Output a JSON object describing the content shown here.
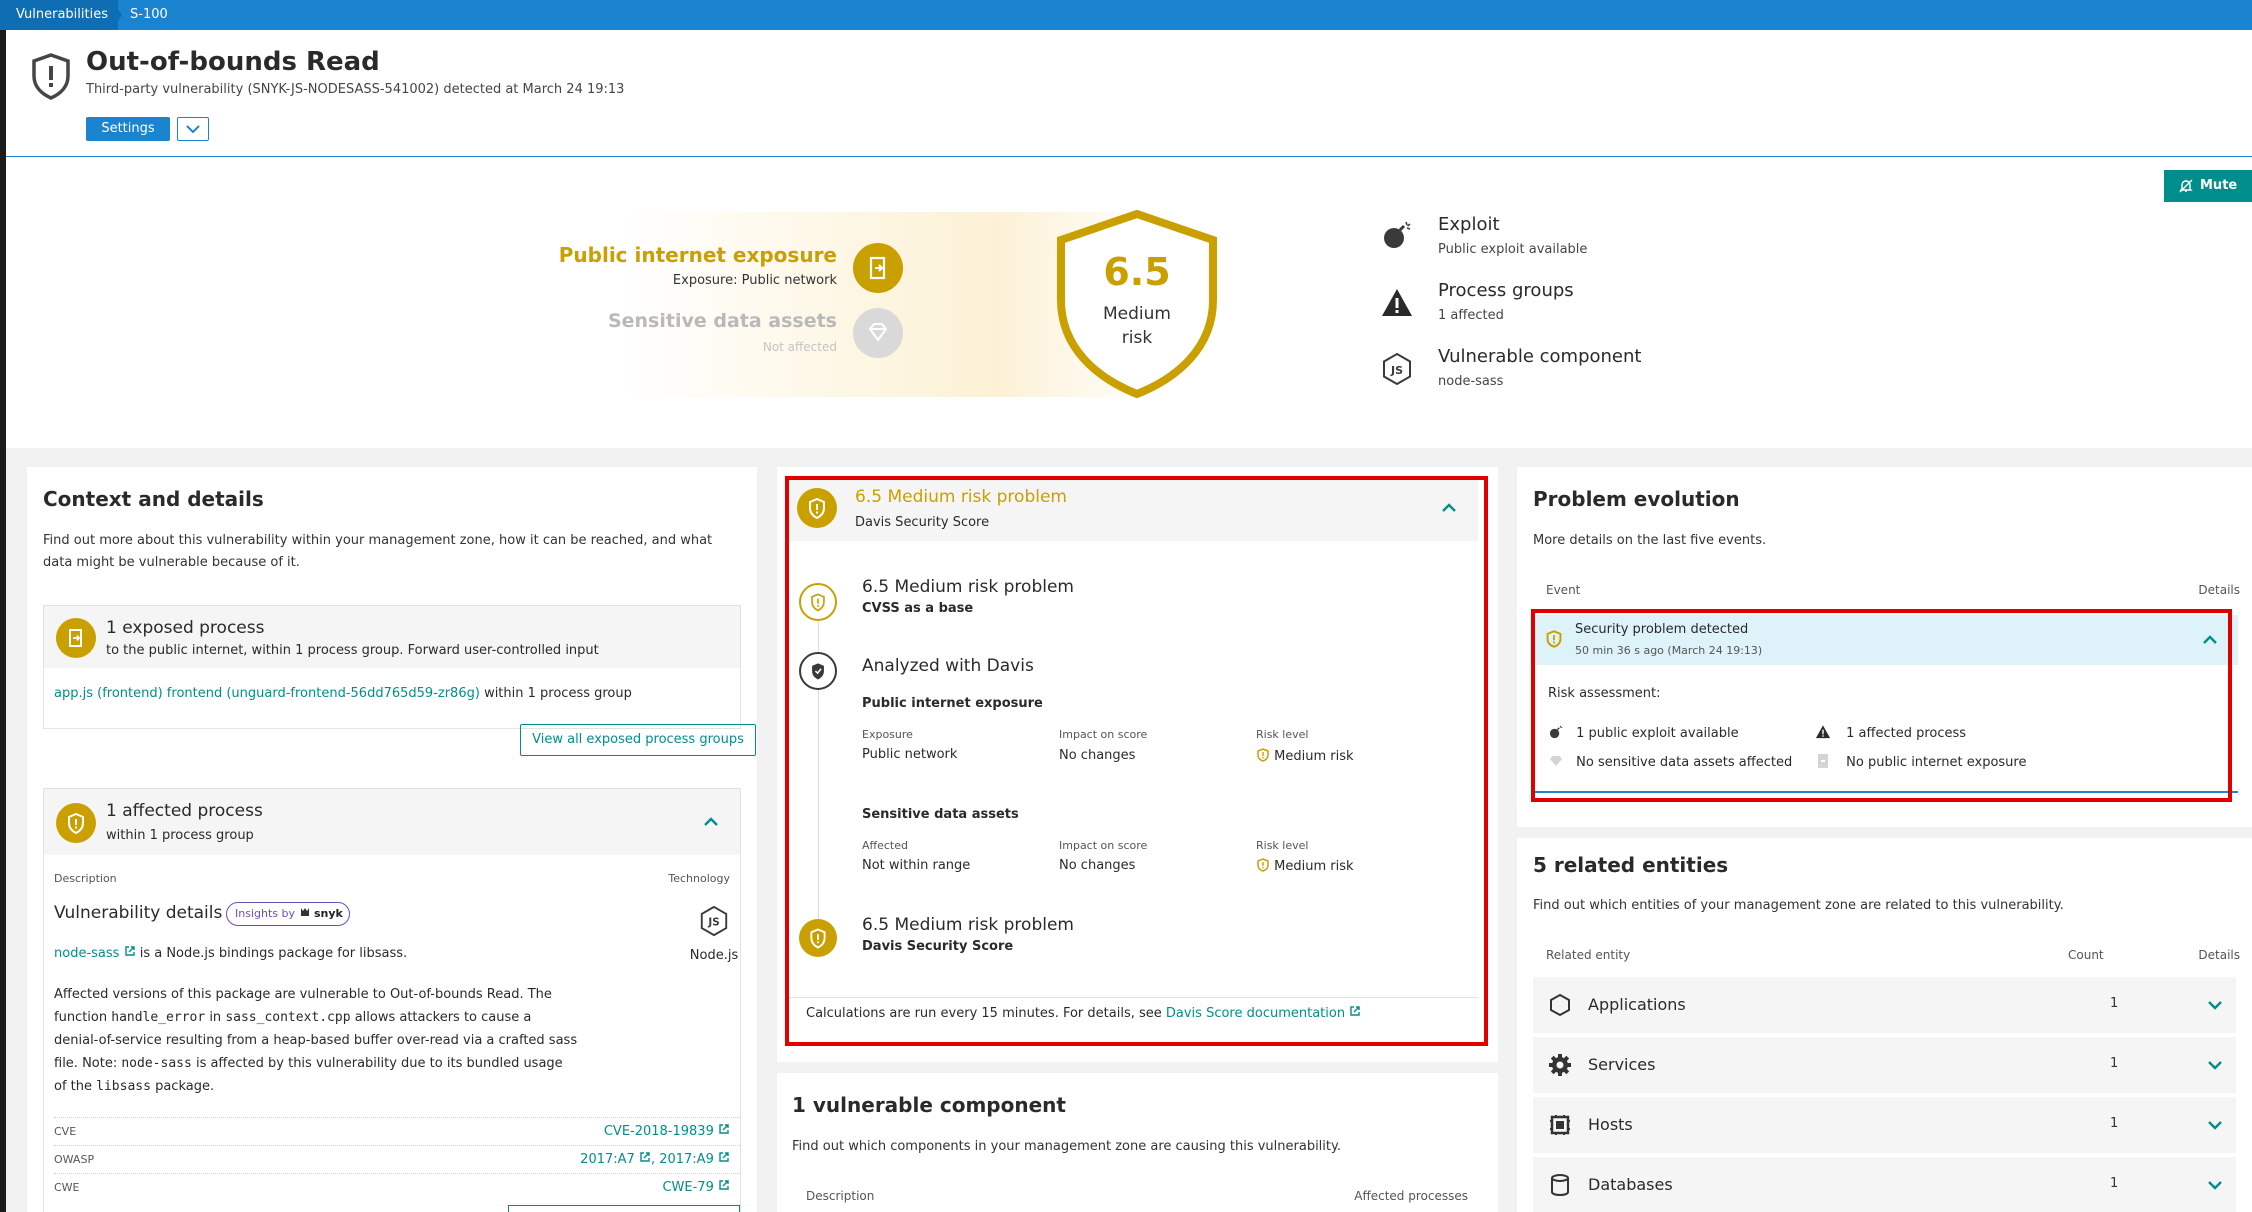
{
  "breadcrumb": {
    "items": [
      "Vulnerabilities",
      "S-100"
    ]
  },
  "header": {
    "title": "Out-of-bounds Read",
    "subtitle": "Third-party vulnerability (SNYK-JS-NODESASS-541002) detected at March 24 19:13",
    "settings_label": "Settings"
  },
  "mute_label": "Mute",
  "hero": {
    "exposure_title": "Public internet exposure",
    "exposure_sub": "Exposure: Public network",
    "sensitive_title": "Sensitive data assets",
    "sensitive_sub": "Not affected",
    "score": "6.5",
    "risk_line1": "Medium",
    "risk_line2": "risk",
    "facts": [
      {
        "title": "Exploit",
        "sub": "Public exploit available",
        "icon": "bomb-icon"
      },
      {
        "title": "Process groups",
        "sub": "1 affected",
        "icon": "warning-icon"
      },
      {
        "title": "Vulnerable component",
        "sub": "node-sass",
        "icon": "nodejs-icon"
      }
    ]
  },
  "context": {
    "title": "Context and details",
    "desc": "Find out more about this vulnerability within your management zone, how it can be reached, and what data might be vulnerable because of it.",
    "exposed": {
      "title": "1 exposed process",
      "sub": "to the public internet, within 1 process group. Forward user-controlled input",
      "link": "app.js (frontend) frontend (unguard-frontend-56dd765d59-zr86g)",
      "link_suffix": "within 1 process group",
      "button": "View all exposed process groups"
    },
    "affected": {
      "title": "1 affected process",
      "sub": "within 1 process group",
      "col_description": "Description",
      "col_technology": "Technology",
      "vuln_title": "Vulnerability details",
      "insights_by": "Insights by",
      "snyk": "snyk",
      "pkg_link": "node-sass",
      "pkg_desc": "is a Node.js bindings package for libsass.",
      "tech_name": "Node.js",
      "para": {
        "t1": "Affected versions of this package are vulnerable to Out-of-bounds Read. The",
        "t2": "function",
        "c1": "handle_error",
        "t3": "in",
        "c2": "sass_context.cpp",
        "t4": "allows attackers to cause a",
        "t5": "denial-of-service resulting from a heap-based buffer over-read via a crafted sass",
        "t6": "file. Note:",
        "c3": "node-sass",
        "t7": "is affected by this vulnerability due to its bundled usage",
        "t8": "of the",
        "c4": "libsass",
        "t9": "package."
      },
      "refs": [
        {
          "label": "CVE",
          "value": "CVE-2018-19839"
        },
        {
          "label": "OWASP",
          "value": "2017:A7",
          "value2": "2017:A9"
        },
        {
          "label": "CWE",
          "value": "CWE-79"
        }
      ]
    }
  },
  "risk": {
    "title": "6.5 Medium risk problem",
    "sub": "Davis Security Score",
    "steps": [
      {
        "title": "6.5 Medium risk problem",
        "sub": "CVSS as a base"
      },
      {
        "title": "Analyzed with Davis"
      },
      {
        "title": "6.5 Medium risk problem",
        "sub": "Davis Security Score"
      }
    ],
    "exposure_section": "Public internet exposure",
    "sensitive_section": "Sensitive data assets",
    "col_exposure": "Exposure",
    "col_affected": "Affected",
    "col_impact": "Impact on score",
    "col_risk": "Risk level",
    "exposure_value": "Public network",
    "sensitive_value": "Not within range",
    "impact_value": "No changes",
    "risk_value": "Medium risk",
    "footer_text": "Calculations are run every 15 minutes. For details, see",
    "footer_link": "Davis Score documentation"
  },
  "component": {
    "title": "1 vulnerable component",
    "desc": "Find out which components in your management zone are causing this vulnerability.",
    "col_description": "Description",
    "col_affected": "Affected processes"
  },
  "evolution": {
    "title": "Problem evolution",
    "desc": "More details on the last five events.",
    "col_event": "Event",
    "col_details": "Details",
    "event_title": "Security problem detected",
    "event_time": "50 min 36 s ago (March 24 19:13)",
    "risk_label": "Risk assessment:",
    "items": [
      "1 public exploit available",
      "1 affected process",
      "No sensitive data assets affected",
      "No public internet exposure"
    ]
  },
  "related": {
    "title": "5 related entities",
    "desc": "Find out which entities of your management zone are related to this vulnerability.",
    "col_entity": "Related entity",
    "col_count": "Count",
    "col_details": "Details",
    "rows": [
      {
        "name": "Applications",
        "count": "1"
      },
      {
        "name": "Services",
        "count": "1"
      },
      {
        "name": "Hosts",
        "count": "1"
      },
      {
        "name": "Databases",
        "count": "1"
      }
    ]
  },
  "colors": {
    "accent": "#1a84d1",
    "gold": "#c9a000",
    "teal": "#008e8c",
    "highlight": "#e00000"
  }
}
